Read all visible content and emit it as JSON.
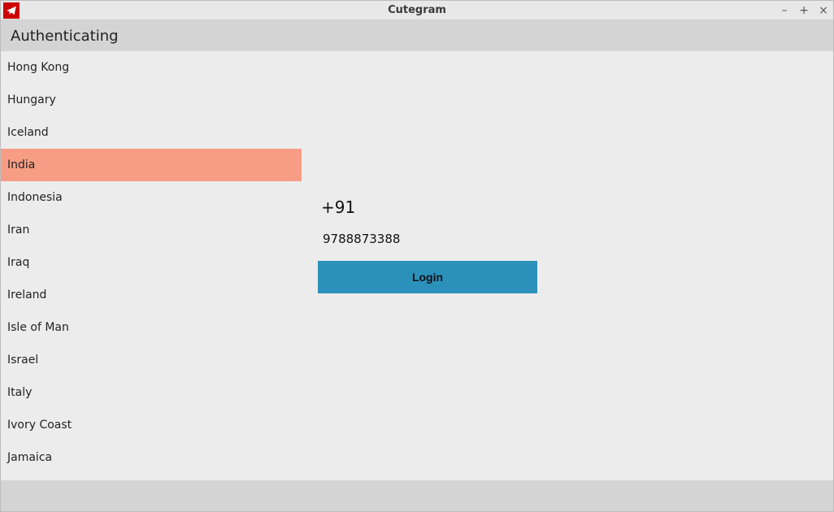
{
  "window": {
    "title": "Cutegram",
    "controls": {
      "minimize": "–",
      "maximize": "+",
      "close": "×"
    }
  },
  "header": {
    "title": "Authenticating"
  },
  "sidebar": {
    "selected_index": 3,
    "items": [
      {
        "label": "Hong Kong"
      },
      {
        "label": "Hungary"
      },
      {
        "label": "Iceland"
      },
      {
        "label": "India"
      },
      {
        "label": "Indonesia"
      },
      {
        "label": "Iran"
      },
      {
        "label": "Iraq"
      },
      {
        "label": "Ireland"
      },
      {
        "label": "Isle of Man"
      },
      {
        "label": "Israel"
      },
      {
        "label": "Italy"
      },
      {
        "label": "Ivory Coast"
      },
      {
        "label": "Jamaica"
      }
    ]
  },
  "form": {
    "dial_code": "+91",
    "phone_value": "9788873388",
    "login_label": "Login"
  },
  "colors": {
    "selected_bg": "#f79d85",
    "button_bg": "#2b91bb",
    "app_icon_bg": "#cc0000"
  }
}
